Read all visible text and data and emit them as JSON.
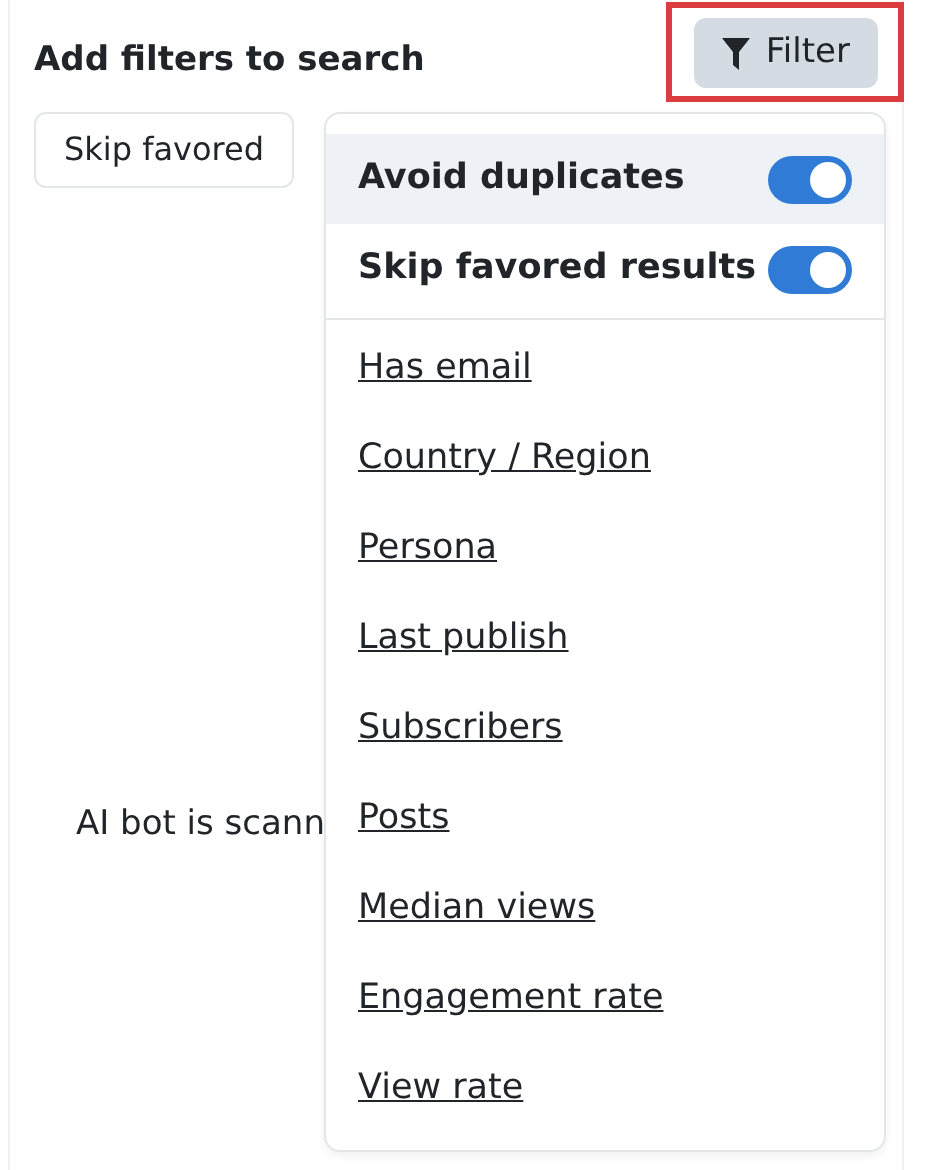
{
  "header": {
    "title": "Add filters to search",
    "filter_button": {
      "label": "Filter",
      "highlighted": true
    }
  },
  "chips": [
    {
      "label": "Skip favored"
    }
  ],
  "status_text": "AI bot is scann",
  "dropdown": {
    "toggles": [
      {
        "label": "Avoid duplicates",
        "on": true,
        "highlighted": true
      },
      {
        "label": "Skip favored results",
        "on": true,
        "highlighted": false
      }
    ],
    "items": [
      "Has email",
      "Country / Region",
      "Persona",
      "Last publish",
      "Subscribers",
      "Posts",
      "Median views",
      "Engagement rate",
      "View rate"
    ]
  }
}
